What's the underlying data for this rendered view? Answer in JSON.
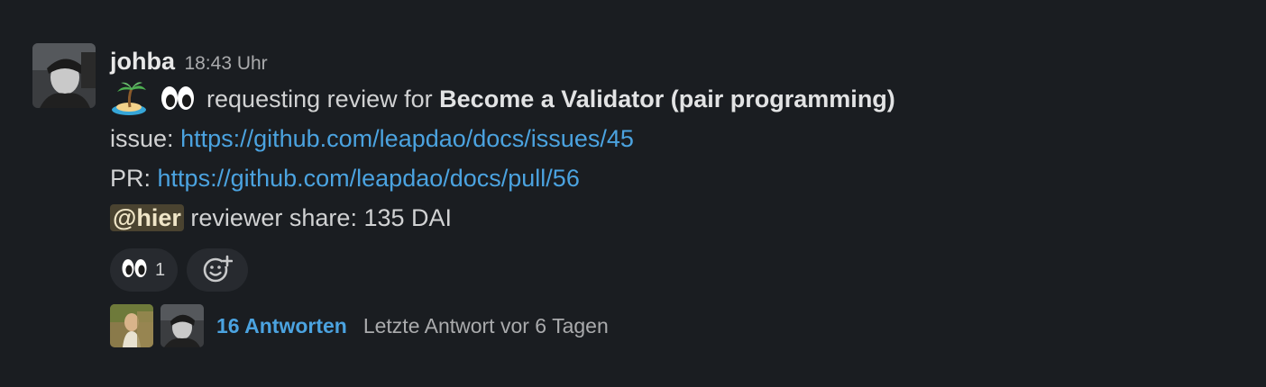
{
  "message": {
    "author": "johba",
    "timestamp": "18:43 Uhr",
    "line1": {
      "emojis": [
        "desert-island-emoji",
        "eyes-emoji"
      ],
      "text": "requesting review for",
      "bold": "Become a Validator (pair programming)"
    },
    "line2": {
      "label": "issue:",
      "link": "https://github.com/leapdao/docs/issues/45"
    },
    "line3": {
      "label": "PR:",
      "link": "https://github.com/leapdao/docs/pull/56"
    },
    "line4": {
      "mention": "@hier",
      "text": "reviewer share: 135 DAI"
    }
  },
  "reactions": [
    {
      "emoji": "eyes-emoji",
      "count": "1"
    }
  ],
  "add_reaction_icon": "add-emoji-icon",
  "thread": {
    "reply_count": "16 Antworten",
    "last_reply": "Letzte Antwort vor 6 Tagen"
  },
  "colors": {
    "background": "#1a1d21",
    "link": "#4ba3e0",
    "mention_bg": "#4a4330"
  }
}
